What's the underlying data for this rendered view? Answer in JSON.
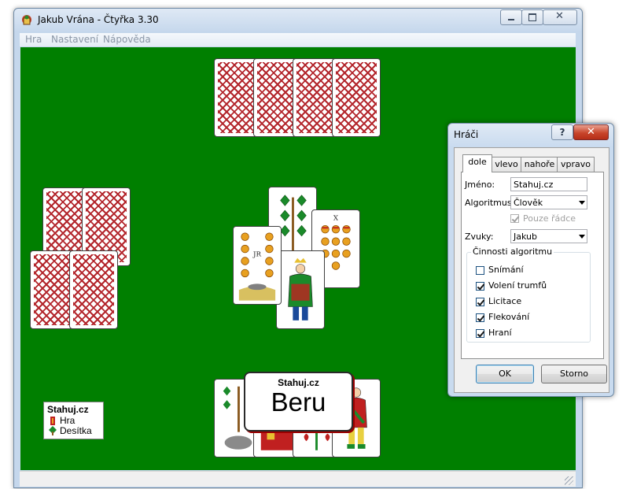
{
  "window": {
    "title": "Jakub Vrána - Čtyřka 3.30",
    "minimize_glyph": "—",
    "maximize_glyph": "☐",
    "close_glyph": "✕"
  },
  "menu": [
    {
      "label": "Hra"
    },
    {
      "label": "Nastavení"
    },
    {
      "label": "Nápověda"
    }
  ],
  "table": {
    "felt_color": "#007f00",
    "card_back_color": "#b3262c",
    "card_center_jr_label": "JR",
    "card_center_x_label": "X"
  },
  "scorebox": {
    "player": "Stahuj.cz",
    "line1": "Hra",
    "line2": "Desítka"
  },
  "bubble": {
    "player": "Stahuj.cz",
    "text": "Beru"
  },
  "dialog": {
    "title": "Hráči",
    "help_glyph": "?",
    "close_glyph": "✕",
    "tabs": [
      {
        "label": "dole"
      },
      {
        "label": "vlevo"
      },
      {
        "label": "nahoře"
      },
      {
        "label": "vpravo"
      }
    ],
    "name_label": "Jméno:",
    "name_value": "Stahuj.cz",
    "algorithm_label": "Algoritmus:",
    "algorithm_value": "Člověk",
    "only_rows_label": "Pouze řádce",
    "sounds_label": "Zvuky:",
    "sounds_value": "Jakub",
    "group_title": "Činnosti algoritmu",
    "activities": [
      {
        "label": "Snímání",
        "checked": false
      },
      {
        "label": "Volení trumfů",
        "checked": true
      },
      {
        "label": "Licitace",
        "checked": true
      },
      {
        "label": "Flekování",
        "checked": true
      },
      {
        "label": "Hraní",
        "checked": true
      }
    ],
    "ok_label": "OK",
    "cancel_label": "Storno"
  }
}
